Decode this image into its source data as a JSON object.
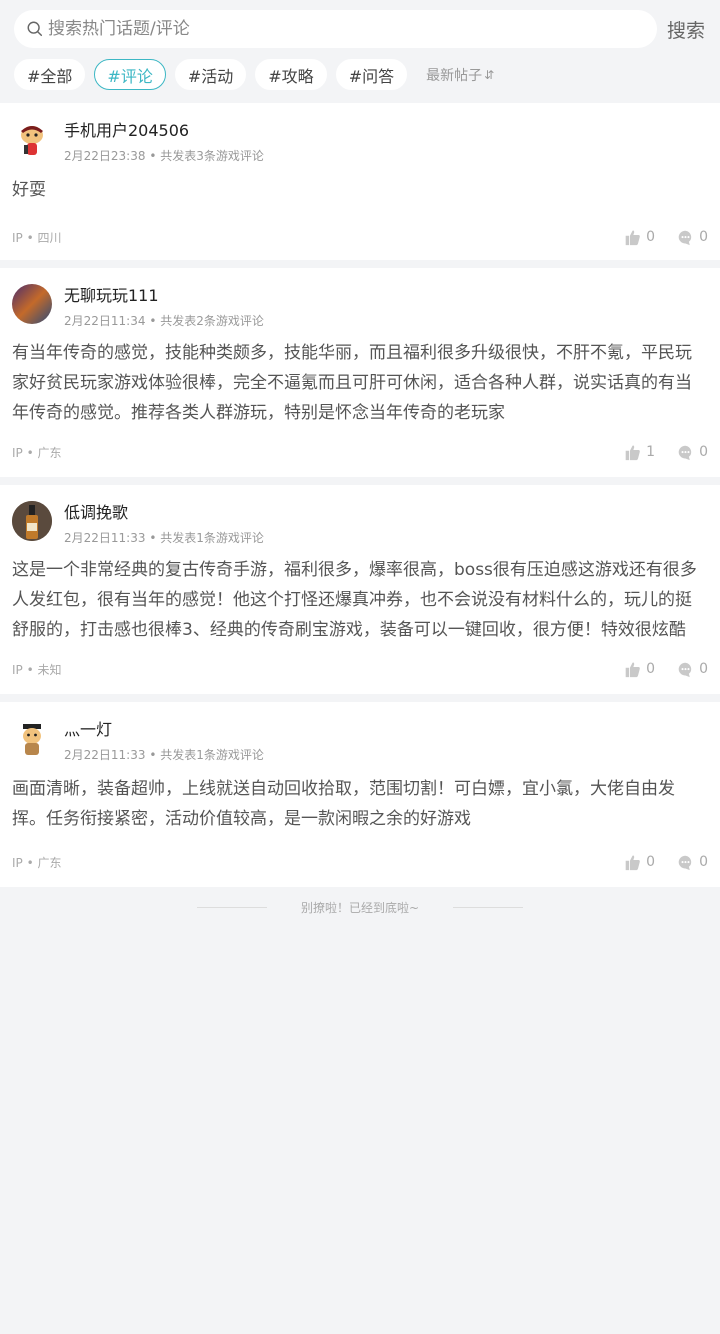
{
  "search": {
    "placeholder": "搜索热门话题/评论",
    "button_label": "搜索"
  },
  "tabs": [
    {
      "label": "#全部",
      "active": false
    },
    {
      "label": "#评论",
      "active": true
    },
    {
      "label": "#活动",
      "active": false
    },
    {
      "label": "#攻略",
      "active": false
    },
    {
      "label": "#问答",
      "active": false
    }
  ],
  "sort_label": "最新帖子",
  "posts": [
    {
      "username": "手机用户204506",
      "date": "2月22日23:38",
      "summary": "• 共发表3条游戏评论",
      "content": "好耍",
      "ip": "IP • 四川",
      "likes": "0",
      "comments": "0"
    },
    {
      "username": "无聊玩玩111",
      "date": "2月22日11:34",
      "summary": "• 共发表2条游戏评论",
      "content": "有当年传奇的感觉，技能种类颇多，技能华丽，而且福利很多升级很快，不肝不氪，平民玩家好贫民玩家游戏体验很棒，完全不逼氪而且可肝可休闲，适合各种人群，说实话真的有当年传奇的感觉。推荐各类人群游玩，特别是怀念当年传奇的老玩家",
      "ip": "IP • 广东",
      "likes": "1",
      "comments": "0"
    },
    {
      "username": "低调挽歌",
      "date": "2月22日11:33",
      "summary": "• 共发表1条游戏评论",
      "content": "这是一个非常经典的复古传奇手游，福利很多，爆率很高，boss很有压迫感这游戏还有很多人发红包，很有当年的感觉！他这个打怪还爆真冲券，也不会说没有材料什么的，玩儿的挺舒服的，打击感也很棒3、经典的传奇刷宝游戏，装备可以一键回收，很方便！特效很炫酷",
      "ip": "IP • 未知",
      "likes": "0",
      "comments": "0"
    },
    {
      "username": "灬一灯",
      "date": "2月22日11:33",
      "summary": "• 共发表1条游戏评论",
      "content": "画面清晰，装备超帅，上线就送自动回收拾取，范围切割！可白嫖，宜小氯，大佬自由发挥。任务衔接紧密，活动价值较高，是一款闲暇之余的好游戏",
      "ip": "IP • 广东",
      "likes": "0",
      "comments": "0"
    }
  ],
  "end_text": "别撩啦！已经到底啦~",
  "colors": {
    "accent": "#3cb7c4",
    "background": "#f3f4f6"
  }
}
